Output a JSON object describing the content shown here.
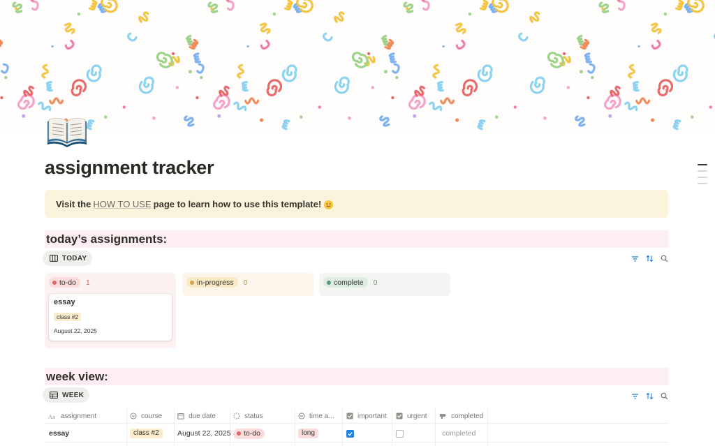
{
  "page": {
    "title": "assignment tracker",
    "icon": "open-book-icon"
  },
  "callout": {
    "prefix": "Visit the",
    "link": "HOW TO USE",
    "suffix": "page to learn how to use this template!",
    "emoji": "smiling-face-icon"
  },
  "today": {
    "heading": "today’s assignments:",
    "view_label": "TODAY",
    "columns": [
      {
        "label": "to-do",
        "count": "1",
        "color": "#e16a6a",
        "bg": "#fbdcdc"
      },
      {
        "label": "in-progress",
        "count": "0",
        "color": "#d4a445",
        "bg": "#f8e9c5"
      },
      {
        "label": "complete",
        "count": "0",
        "color": "#5e9a77",
        "bg": "#dcece2"
      }
    ],
    "card": {
      "title": "essay",
      "tag": "class #2",
      "date": "August 22, 2025"
    }
  },
  "week": {
    "heading": "week view:",
    "view_label": "WEEK",
    "columns": [
      "assignment",
      "course",
      "due date",
      "status",
      "time a...",
      "important",
      "urgent",
      "completed"
    ],
    "rows": [
      {
        "assignment": "essay",
        "course": "class #2",
        "due_date": "August 22, 2025",
        "status": "to-do",
        "time": "long",
        "important": true,
        "urgent": false,
        "completed": "completed"
      }
    ]
  },
  "colors": {
    "accent": "#2383e2",
    "heading_bg": "#fdeef2",
    "callout_bg": "#fbf3db"
  }
}
